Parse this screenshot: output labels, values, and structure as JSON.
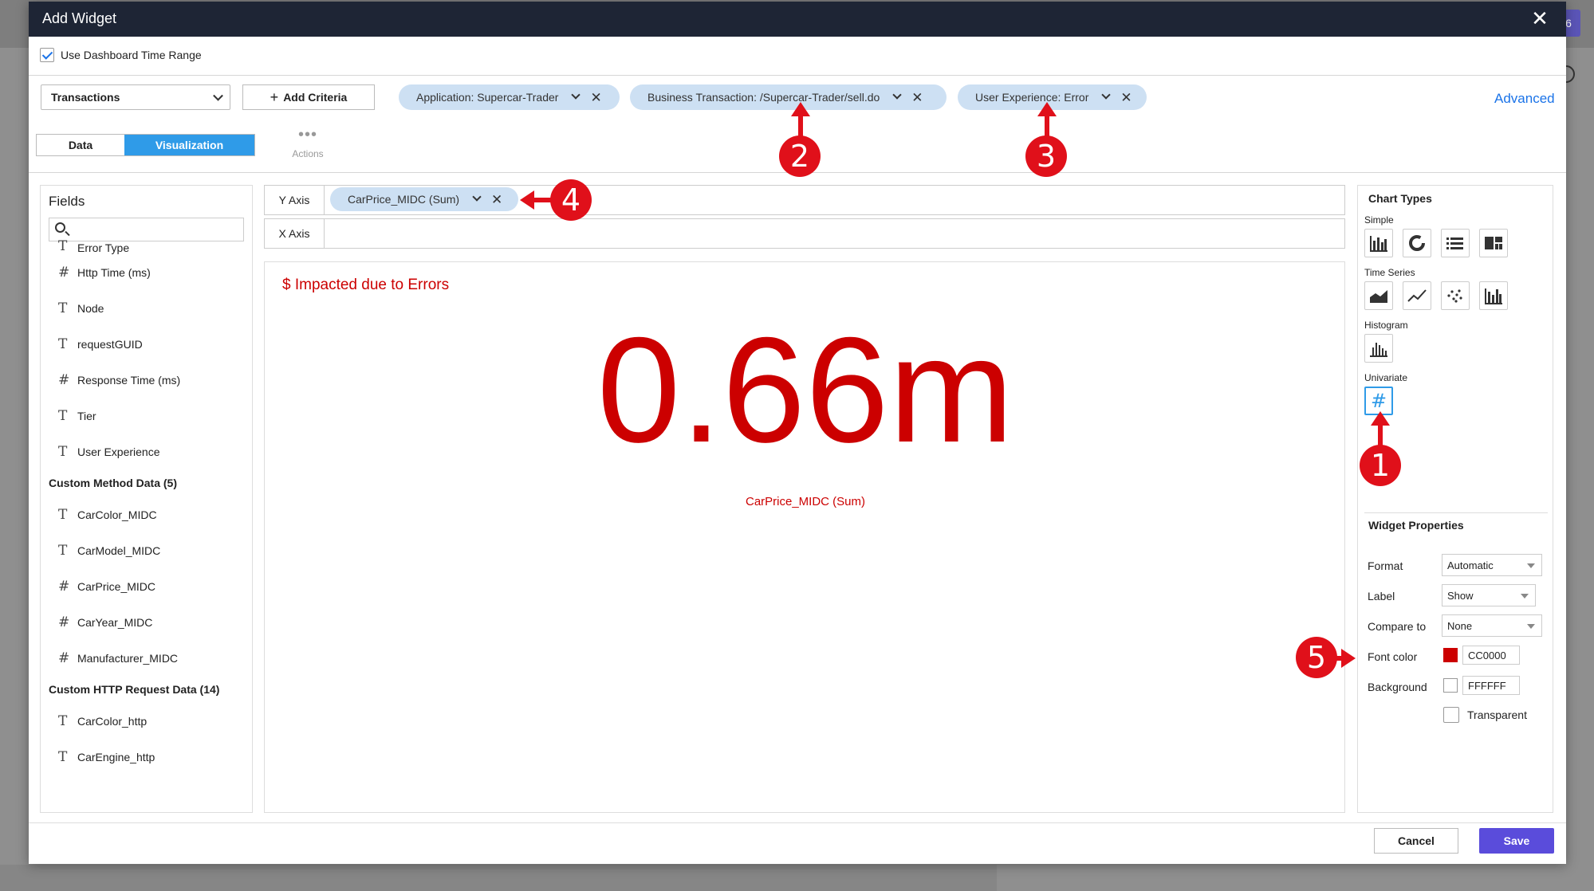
{
  "dialog": {
    "title": "Add Widget"
  },
  "time_range": {
    "label": "Use Dashboard Time Range",
    "checked": true
  },
  "criteria": {
    "source_select": "Transactions",
    "add_button": "Add Criteria",
    "chips": [
      "Application: Supercar-Trader",
      "Business Transaction: /Supercar-Trader/sell.do",
      "User Experience: Error"
    ],
    "advanced": "Advanced"
  },
  "tabs": [
    "Data",
    "Visualization"
  ],
  "actions_label": "Actions",
  "fields": {
    "header": "Fields",
    "items_top": [
      {
        "icon": "T",
        "label": "Error Type"
      },
      {
        "icon": "#",
        "label": "Http Time (ms)"
      },
      {
        "icon": "T",
        "label": "Node"
      },
      {
        "icon": "T",
        "label": "requestGUID"
      },
      {
        "icon": "#",
        "label": "Response Time (ms)"
      },
      {
        "icon": "T",
        "label": "Tier"
      },
      {
        "icon": "T",
        "label": "User Experience"
      }
    ],
    "group1": "Custom Method Data (5)",
    "items_g1": [
      {
        "icon": "T",
        "label": "CarColor_MIDC"
      },
      {
        "icon": "T",
        "label": "CarModel_MIDC"
      },
      {
        "icon": "#",
        "label": "CarPrice_MIDC"
      },
      {
        "icon": "#",
        "label": "CarYear_MIDC"
      },
      {
        "icon": "#",
        "label": "Manufacturer_MIDC"
      }
    ],
    "group2": "Custom HTTP Request Data (14)",
    "items_g2": [
      {
        "icon": "T",
        "label": "CarColor_http"
      },
      {
        "icon": "T",
        "label": "CarEngine_http"
      }
    ]
  },
  "axes": {
    "y_label": "Y Axis",
    "y_chip": "CarPrice_MIDC (Sum)",
    "x_label": "X Axis"
  },
  "preview": {
    "title": "$ Impacted due to Errors",
    "value": "0.66m",
    "subtitle": "CarPrice_MIDC (Sum)",
    "color": "#cc0000"
  },
  "chart_types": {
    "header": "Chart Types",
    "simple": "Simple",
    "time_series": "Time Series",
    "histogram": "Histogram",
    "univariate": "Univariate"
  },
  "widget_properties": {
    "header": "Widget Properties",
    "format_label": "Format",
    "format_value": "Automatic",
    "label_label": "Label",
    "label_value": "Show",
    "compare_label": "Compare to",
    "compare_value": "None",
    "font_color_label": "Font color",
    "font_color_value": "CC0000",
    "background_label": "Background",
    "background_value": "FFFFFF",
    "transparent_label": "Transparent"
  },
  "annotations": [
    "1",
    "2",
    "3",
    "4",
    "5"
  ],
  "footer": {
    "cancel": "Cancel",
    "save": "Save"
  },
  "backdrop": {
    "badge": "6"
  }
}
